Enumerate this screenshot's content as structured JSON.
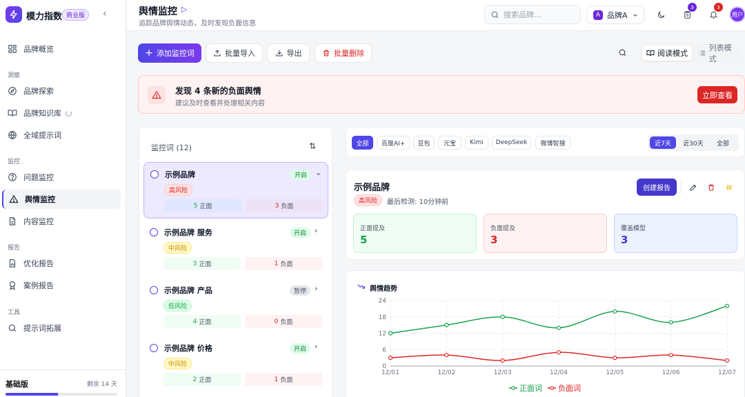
{
  "app": {
    "name": "模力指数",
    "badge": "商业版",
    "collapse_glyph": "‹"
  },
  "sidebar": {
    "items": [
      {
        "label": "品牌概览"
      },
      {
        "section": "洞察"
      },
      {
        "label": "品牌探索"
      },
      {
        "label": "品牌知识库"
      },
      {
        "label": "全域提示词"
      },
      {
        "section": "监控"
      },
      {
        "label": "问题监控"
      },
      {
        "label": "舆情监控"
      },
      {
        "label": "内容监控"
      },
      {
        "section": "报告"
      },
      {
        "label": "优化报告"
      },
      {
        "label": "案例报告"
      },
      {
        "section": "工具"
      },
      {
        "label": "提示词拓展"
      }
    ],
    "plan": {
      "name": "基础版",
      "remaining": "剩余 14 天",
      "progress": 0.47
    }
  },
  "header": {
    "title": "舆情监控",
    "subtitle": "追踪品牌舆情动态，及时发现负面信息",
    "search_placeholder": "搜索品牌...",
    "brand": {
      "letter": "A",
      "name": "品牌A"
    },
    "tasks_badge": "3",
    "notif_badge": "3",
    "avatar": "用户"
  },
  "toolbar": {
    "add": "添加监控词",
    "import": "批量导入",
    "export": "导出",
    "delete": "批量删除",
    "read_mode": "阅读模式",
    "list_mode": "列表模式"
  },
  "alert": {
    "title": "发现 4 条新的负面舆情",
    "subtitle": "建议及时查看并处理相关内容",
    "action": "立即查看"
  },
  "watchlist": {
    "title": "监控词 (12)",
    "items": [
      {
        "name": "示例品牌",
        "status": "开启",
        "risk": "高风险",
        "pos": "5",
        "neg": "3",
        "pos_label": "正面",
        "neg_label": "负面"
      },
      {
        "name": "示例品牌 服务",
        "status": "开启",
        "risk": "中风险",
        "pos": "3",
        "neg": "1",
        "pos_label": "正面",
        "neg_label": "负面"
      },
      {
        "name": "示例品牌 产品",
        "status": "暂停",
        "risk": "低风险",
        "pos": "4",
        "neg": "0",
        "pos_label": "正面",
        "neg_label": "负面"
      },
      {
        "name": "示例品牌 价格",
        "status": "开启",
        "risk": "中风险",
        "pos": "2",
        "neg": "1",
        "pos_label": "正面",
        "neg_label": "负面"
      }
    ]
  },
  "filters": {
    "models": [
      "全部",
      "百度AI+",
      "豆包",
      "元宝",
      "Kimi",
      "DeepSeek",
      "微博智搜"
    ],
    "times": [
      "近7天",
      "近30天",
      "全部"
    ]
  },
  "detail": {
    "title": "示例品牌",
    "risk": "高风险",
    "last_check": "最后检测: 10分钟前",
    "create_report": "创建报告",
    "stats": [
      {
        "label": "正面提及",
        "value": "5"
      },
      {
        "label": "负面提及",
        "value": "3"
      },
      {
        "label": "覆盖模型",
        "value": "3"
      }
    ]
  },
  "trend": {
    "title": "舆情趋势"
  },
  "colors": {
    "accent": "#4f46e5",
    "positive": "#16a34a",
    "negative": "#dc2626"
  },
  "chart_data": {
    "type": "line",
    "x": [
      "12/01",
      "12/02",
      "12/03",
      "12/04",
      "12/05",
      "12/06",
      "12/07"
    ],
    "series": [
      {
        "name": "正面词",
        "values": [
          12,
          15,
          18,
          14,
          20,
          16,
          22
        ],
        "color": "#16a34a"
      },
      {
        "name": "负面词",
        "values": [
          3,
          4,
          2,
          5,
          3,
          4,
          2
        ],
        "color": "#dc2626"
      }
    ],
    "ylim": [
      0,
      24
    ],
    "yticks": [
      0,
      6,
      12,
      18,
      24
    ],
    "grid": true,
    "legend": "bottom"
  }
}
